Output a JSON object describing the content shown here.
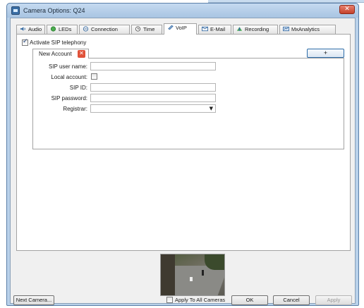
{
  "window": {
    "title": "Camera Options: Q24",
    "close_symbol": "✕"
  },
  "tabs": [
    {
      "label": "Audio",
      "icon": "speaker-icon",
      "icon_color": "#3a6ea5"
    },
    {
      "label": "LEDs",
      "icon": "led-icon",
      "icon_color": "#4caf50"
    },
    {
      "label": "Connection",
      "icon": "connection-icon",
      "icon_color": "#3a6ea5"
    },
    {
      "label": "Time",
      "icon": "clock-icon",
      "icon_color": "#555555"
    },
    {
      "label": "VoIP",
      "icon": "phone-icon",
      "icon_color": "#3a6ea5",
      "active": true
    },
    {
      "label": "E-Mail",
      "icon": "mail-icon",
      "icon_color": "#3a6ea5"
    },
    {
      "label": "Recording",
      "icon": "recording-icon",
      "icon_color": "#4caf50"
    },
    {
      "label": "MxAnalytics",
      "icon": "analytics-icon",
      "icon_color": "#3a6ea5"
    }
  ],
  "voip": {
    "activate_label": "Activate SIP telephony",
    "activate_checked": true,
    "account_tab_label": "New Account",
    "add_label": "+",
    "fields": {
      "sip_user_name_label": "SIP user name:",
      "sip_user_name_value": "",
      "local_account_label": "Local account:",
      "local_account_checked": false,
      "sip_id_label": "SIP ID:",
      "sip_id_value": "",
      "sip_password_label": "SIP password:",
      "sip_password_value": "",
      "registrar_label": "Registrar:",
      "registrar_value": ""
    }
  },
  "footer": {
    "next_camera_label": "Next Camera...",
    "apply_all_label": "Apply To All Cameras",
    "ok_label": "OK",
    "cancel_label": "Cancel",
    "apply_label": "Apply"
  },
  "colors": {
    "accent": "#2d6ca8",
    "close_button": "#c4412b",
    "account_close": "#e0523a"
  }
}
